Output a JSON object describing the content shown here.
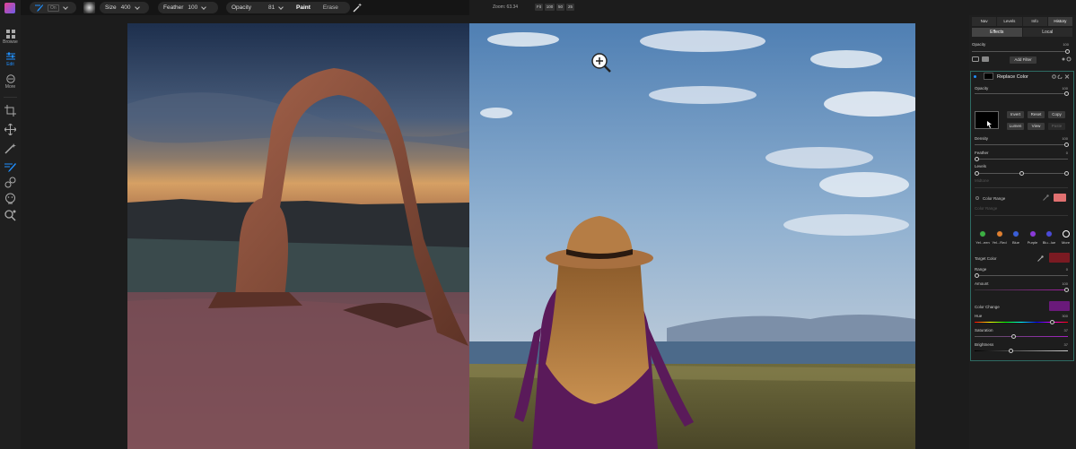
{
  "rail": {
    "items": [
      {
        "label": "Browse",
        "icon": "grid-icon"
      },
      {
        "label": "Edit",
        "icon": "sliders-icon"
      },
      {
        "label": "More",
        "icon": "more-icon"
      }
    ]
  },
  "toolbar": {
    "brush_mode": "On",
    "size_label": "Size",
    "size_value": "400",
    "feather_label": "Feather",
    "feather_value": "100",
    "opacity_label": "Opacity",
    "opacity_value": "81",
    "paint_label": "Paint",
    "erase_label": "Erase"
  },
  "zoombar": {
    "zoom_label": "Zoom: 63.34",
    "fit": "Fit",
    "z100": "100",
    "z50": "50",
    "z25": "25"
  },
  "panel": {
    "tabs": [
      "Nav",
      "Levels",
      "Info",
      "History"
    ],
    "subtabs": [
      "Effects",
      "Local"
    ],
    "layer_opacity_label": "Opacity",
    "layer_opacity_value": "100",
    "add_filter": "Add Filter",
    "filter_name": "Replace Color",
    "f_opacity_label": "Opacity",
    "f_opacity_value": "100",
    "invert": "Invert",
    "reset": "Reset",
    "copy": "Copy",
    "lumen": "Lumen",
    "view": "View",
    "paste": "Paste",
    "density_label": "Density",
    "density_value": "100",
    "feather_label": "Feather",
    "feather_value": "0",
    "levels_label": "Levels",
    "midtone_label": "Midtone",
    "color_range_label": "Color Range",
    "color_range_sub": "Color Range",
    "presets": [
      {
        "label": "Yel...een",
        "color": "#3cb043"
      },
      {
        "label": "Yel...Red",
        "color": "#e08030"
      },
      {
        "label": "Blue",
        "color": "#3a5fd8"
      },
      {
        "label": "Purple",
        "color": "#8a3ad8"
      },
      {
        "label": "Blu...lue",
        "color": "#4a4ad8"
      },
      {
        "label": "More",
        "color": "#ffffff"
      }
    ],
    "target_color_label": "Target Color",
    "target_color": "#7a1a22",
    "range_label": "Range",
    "range_value": "0",
    "amount_label": "Amount",
    "amount_value": "100",
    "color_change_label": "Color Change",
    "color_change": "#6a1a7a",
    "hue_label": "Hue",
    "hue_value": "300",
    "saturation_label": "Saturation",
    "saturation_value": "37",
    "brightness_label": "Brightness",
    "brightness_value": "37",
    "color_range_swatch": "#e07070"
  },
  "colors": {
    "accent": "#1f8fff",
    "filter_border": "#2e6b63"
  }
}
